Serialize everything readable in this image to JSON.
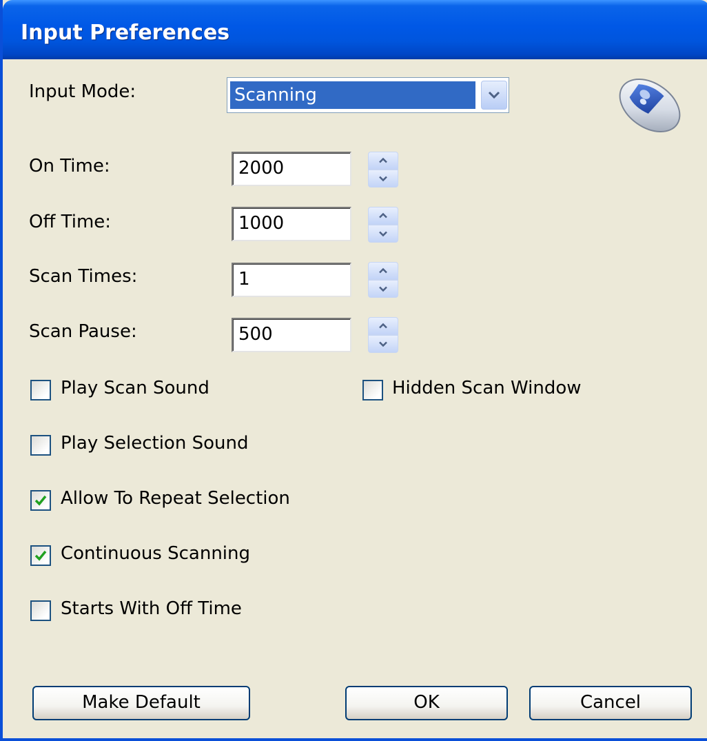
{
  "window": {
    "title": "Input Preferences"
  },
  "input_mode": {
    "label": "Input Mode:",
    "value": "Scanning",
    "icon": "mouse-icon"
  },
  "fields": {
    "on_time": {
      "label": "On Time:",
      "value": "2000"
    },
    "off_time": {
      "label": "Off Time:",
      "value": "1000"
    },
    "scan_times": {
      "label": "Scan Times:",
      "value": "1"
    },
    "scan_pause": {
      "label": "Scan Pause:",
      "value": "500"
    }
  },
  "checkboxes": {
    "play_scan_sound": {
      "label": "Play Scan Sound",
      "checked": false
    },
    "hidden_scan_window": {
      "label": "Hidden Scan Window",
      "checked": false
    },
    "play_selection_sound": {
      "label": "Play Selection Sound",
      "checked": false
    },
    "allow_repeat_selection": {
      "label": "Allow To Repeat Selection",
      "checked": true
    },
    "continuous_scanning": {
      "label": "Continuous Scanning",
      "checked": true
    },
    "starts_with_off_time": {
      "label": "Starts With Off Time",
      "checked": false
    }
  },
  "buttons": {
    "make_default": "Make Default",
    "ok": "OK",
    "cancel": "Cancel"
  },
  "colors": {
    "titlebar": "#0058E6",
    "dialog_bg": "#ECE9D8",
    "selection": "#316AC5",
    "check": "#21A121"
  }
}
